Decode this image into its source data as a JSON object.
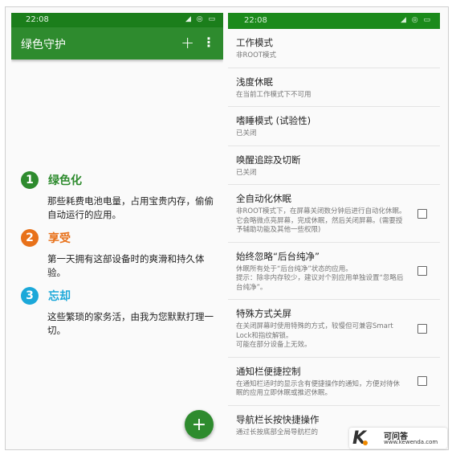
{
  "left": {
    "status_time": "22:08",
    "status_icons": "◢ ◎ ▭",
    "app_title": "绿色守护",
    "plus_label": "+",
    "more_label": "⋮",
    "features": [
      {
        "num": "1",
        "name": "绿色化",
        "desc": "那些耗费电池电量，占用宝贵内存，偷偷自动运行的应用。",
        "color": "#2e8b2e"
      },
      {
        "num": "2",
        "name": "享受",
        "desc": "第一天拥有这部设备时的爽滑和持久体验。",
        "color": "#e8711a"
      },
      {
        "num": "3",
        "name": "忘却",
        "desc": "这些繁琐的家务活，由我为您默默打理一切。",
        "color": "#1ba8d9"
      }
    ],
    "fab_label": "+"
  },
  "right": {
    "status_time": "22:08",
    "status_icons": "◢ ◎ ▭",
    "settings": [
      {
        "title": "工作模式",
        "summary": "非ROOT模式",
        "checkbox": false
      },
      {
        "title": "浅度休眠",
        "summary": "在当前工作模式下不可用",
        "checkbox": false
      },
      {
        "title": "嗜睡模式 (试验性)",
        "summary": "已关闭",
        "checkbox": false
      },
      {
        "title": "唤醒追踪及切断",
        "summary": "已关闭",
        "checkbox": false
      },
      {
        "title": "全自动化休眠",
        "summary": "非ROOT模式下，在屏幕关闭数分钟后进行自动化休眠。它会略微点亮屏幕，完成休眠，然后关闭屏幕。(需要授予辅助功能及其他一些权限)",
        "checkbox": true,
        "checked": false
      },
      {
        "title": "始终忽略“后台纯净”",
        "summary": "休眠所有处于“后台纯净”状态的应用。\n提示：除非内存较少，建议对个别应用单独设置“忽略后台纯净”。",
        "checkbox": true,
        "checked": false
      },
      {
        "title": "特殊方式关屏",
        "summary": "在关闭屏幕时使用特殊的方式，较慢但可兼容Smart Lock和指纹解锁。\n可能在部分设备上无效。",
        "checkbox": true,
        "checked": false
      },
      {
        "title": "通知栏便捷控制",
        "summary": "在通知栏适时的显示含有便捷操作的通知，方便对待休眠的应用立即休眠或推迟休眠。",
        "checkbox": true,
        "checked": false
      },
      {
        "title": "导航栏长按快捷操作",
        "summary": "通过长按底部全局导航栏的",
        "checkbox": false
      }
    ]
  },
  "watermark": {
    "k": "K",
    "title": "可问答",
    "url": "www.kewenda.com"
  }
}
